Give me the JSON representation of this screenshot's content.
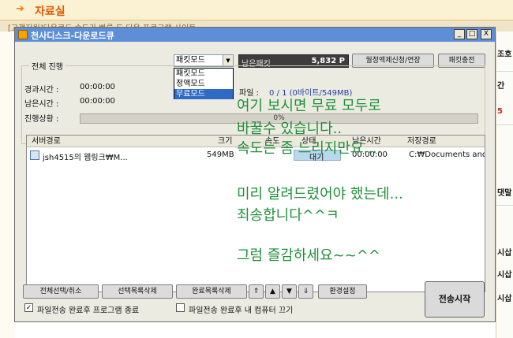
{
  "background_page": {
    "title": "자료실",
    "notice": "[고객지원]다운로드 속도가 빠른 도 다운 프로그램 사이트",
    "right_items": [
      "조호",
      "간",
      "5",
      "댓말",
      "시삽",
      "시삽",
      "시삽"
    ]
  },
  "window": {
    "title": "천사디스크-다운로드큐",
    "controls": {
      "minimize": "_",
      "maximize": "□",
      "close": "X"
    }
  },
  "mode_combo": {
    "value": "패킷모드",
    "options": [
      "패킷모드",
      "정액모드",
      "무료모드"
    ],
    "highlighted": "무료모드"
  },
  "points": {
    "label": "남은패킷",
    "value": "5,832 P"
  },
  "top_buttons": {
    "subscription": "월정액제신청/연장",
    "charge": "패킷충전"
  },
  "progress_group": {
    "title": "전체 진행",
    "elapsed_label": "경과시간 :",
    "elapsed_value": "00:00:00",
    "remaining_label": "남은시간 :",
    "remaining_value": "00:00:00",
    "status_label": "진행상황 :",
    "file_label": "파일 :",
    "file_value": "0 / 1 (0바이트/549MB)",
    "percent": "0%"
  },
  "list": {
    "columns": [
      "서버경로",
      "크기",
      "속도",
      "상태",
      "남은시간",
      "저장경로"
    ],
    "rows": [
      {
        "name": "jsh4515의 웹링크₩M...",
        "size": "549MB",
        "speed": "",
        "status": "대기",
        "remaining": "00:00:00",
        "save_path": "C:₩Documents and"
      }
    ]
  },
  "bottom_buttons": {
    "select_all": "전체선택/취소",
    "delete_selected": "선택목록삭제",
    "delete_completed": "완료목록삭제",
    "move_top": "⇑",
    "move_up": "▲",
    "move_down": "▼",
    "move_bottom": "⇓",
    "settings": "환경설정",
    "start": "전송시작"
  },
  "checkboxes": {
    "exit_after": {
      "label": "파일전송 완료후 프로그램 종료",
      "checked": true
    },
    "shutdown_after": {
      "label": "파일전송 완료후 내 컴퓨터 끄기",
      "checked": false
    }
  },
  "overlay_text": [
    "여기 보시면 무료 모두로",
    "바꿀수 있습니다..",
    "속도는 좀 느리지만요....",
    "미리 알려드렸어야 했는데...",
    "죄송합니다^^ㅋ",
    "그럼 즐감하세요~~^^"
  ],
  "colors": {
    "titlebar": "#5e8ed6",
    "overlay_text": "#1f8f3a",
    "selection": "#316ac5"
  }
}
